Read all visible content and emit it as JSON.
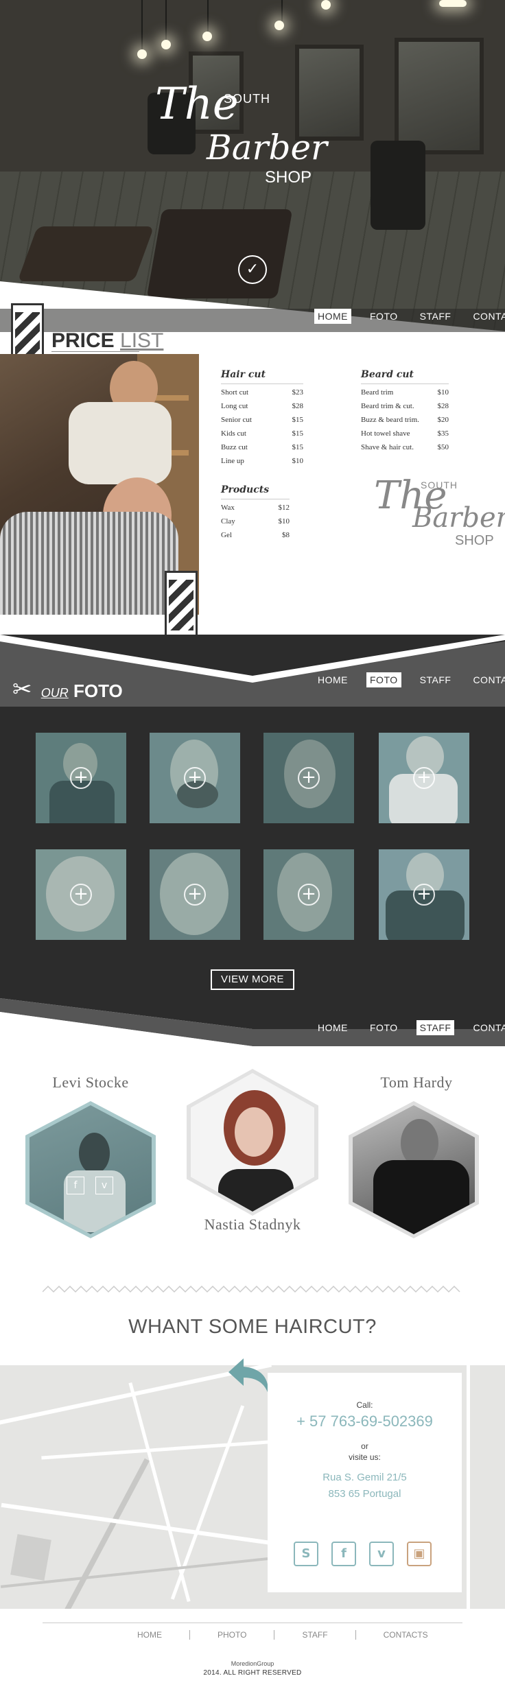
{
  "brand": {
    "the": "The",
    "south": "SOUTH",
    "barber": "Barber",
    "shop": "SHOP"
  },
  "nav": {
    "home": "HOME",
    "foto": "FOTO",
    "staff": "STAFF",
    "contact": "CONTACT"
  },
  "price": {
    "title_bold": "PRICE",
    "title_thin": "LIST",
    "haircut": {
      "heading": "Hair cut",
      "items": [
        {
          "name": "Short cut",
          "price": "$23"
        },
        {
          "name": "Long cut",
          "price": "$28"
        },
        {
          "name": "Senior cut",
          "price": "$15"
        },
        {
          "name": "Kids cut",
          "price": "$15"
        },
        {
          "name": "Buzz cut",
          "price": "$15"
        },
        {
          "name": "Line up",
          "price": "$10"
        }
      ]
    },
    "beardcut": {
      "heading": "Beard cut",
      "items": [
        {
          "name": "Beard trim",
          "price": "$10"
        },
        {
          "name": "Beard trim & cut.",
          "price": "$28"
        },
        {
          "name": "Buzz & beard trim.",
          "price": "$20"
        },
        {
          "name": "Hot towel shave",
          "price": "$35"
        },
        {
          "name": "Shave & hair cut.",
          "price": "$50"
        }
      ]
    },
    "products": {
      "heading": "Products",
      "items": [
        {
          "name": "Wax",
          "price": "$12"
        },
        {
          "name": "Clay",
          "price": "$10"
        },
        {
          "name": "Gel",
          "price": "$8"
        }
      ]
    }
  },
  "foto": {
    "title_our": "OUR",
    "title_foto": "FOTO",
    "view_more": "VIEW MORE"
  },
  "staff": {
    "members": [
      "Levi Stocke",
      "Nastia Stadnyk",
      "Tom Hardy"
    ]
  },
  "contact": {
    "headline": "WHANT SOME HAIRCUT?",
    "call_label": "Call:",
    "phone": "+ 57 763-69-502369",
    "or_label": "or",
    "visit_label": "visite us:",
    "address_line1": "Rua S. Gemil 21/5",
    "address_line2": "853 65 Portugal"
  },
  "footer": {
    "home": "HOME",
    "photo": "PHOTO",
    "staff": "STAFF",
    "contacts": "CONTACTS",
    "brand": "MoredionGroup",
    "rights": "2014. ALL RIGHT RESERVED"
  },
  "colors": {
    "accent": "#8bb7bb",
    "dark": "#2c2c2c",
    "text": "#333333"
  }
}
